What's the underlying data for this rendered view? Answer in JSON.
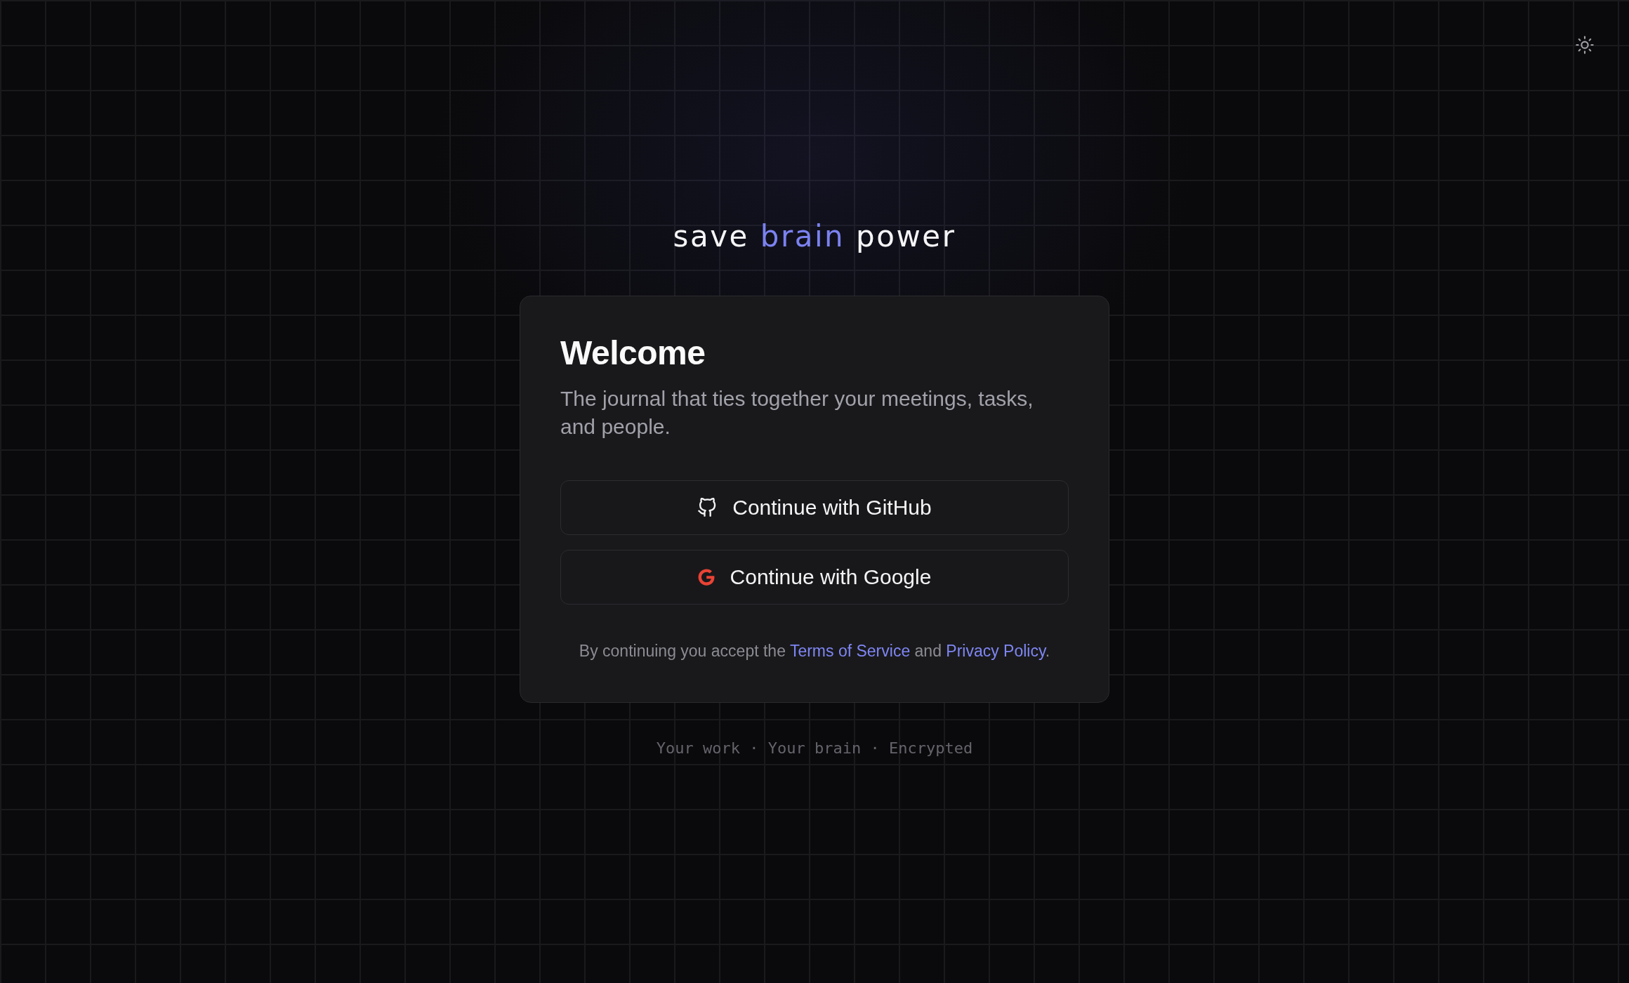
{
  "logo": [
    {
      "text": "save",
      "accent": false
    },
    {
      "text": "brain",
      "accent": true
    },
    {
      "text": "power",
      "accent": false
    }
  ],
  "card": {
    "title": "Welcome",
    "subtitle": "The journal that ties together your meetings, tasks, and people.",
    "buttons": [
      {
        "kind": "github",
        "label": "Continue with GitHub"
      },
      {
        "kind": "google",
        "label": "Continue with Google"
      }
    ],
    "legal": [
      {
        "kind": "text",
        "text": "By continuing you accept the "
      },
      {
        "kind": "link",
        "text": "Terms of Service"
      },
      {
        "kind": "text",
        "text": " and "
      },
      {
        "kind": "link",
        "text": "Privacy Policy"
      },
      {
        "kind": "text",
        "text": "."
      }
    ]
  },
  "footer": "Your work · Your brain · Encrypted"
}
